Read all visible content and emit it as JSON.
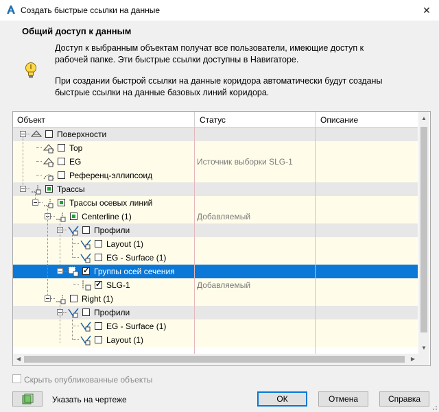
{
  "window": {
    "title": "Создать быстрые ссылки на данные",
    "close_glyph": "✕"
  },
  "header": {
    "heading": "Общий доступ к данным",
    "p1_line1": "Доступ к выбранным объектам получат все пользователи, имеющие доступ к",
    "p1_line2": "рабочей папке. Эти быстрые ссылки доступны в Навигаторе.",
    "p2_line1": "При создании быстрой ссылки на данные коридора автоматически будут созданы",
    "p2_line2": "быстрые ссылки на данные базовых линий коридора."
  },
  "tree": {
    "columns": [
      "Объект",
      "Статус",
      "Описание"
    ],
    "rows": [
      {
        "label": "Поверхности",
        "status": "",
        "checked": false,
        "type": "group",
        "icon": "surface-folder-icon"
      },
      {
        "label": "Top",
        "status": "",
        "checked": false,
        "type": "leaf",
        "icon": "surface-icon"
      },
      {
        "label": "EG",
        "status": "Источник выборки SLG-1",
        "checked": false,
        "type": "leaf",
        "icon": "surface-icon"
      },
      {
        "label": "Референц-эллипсоид",
        "status": "",
        "checked": false,
        "type": "leaf",
        "icon": "ellipsoid-icon"
      },
      {
        "label": "Трассы",
        "status": "",
        "checked": "partial",
        "type": "group",
        "icon": "alignments-icon"
      },
      {
        "label": "Трассы осевых линий",
        "status": "",
        "checked": "partial",
        "type": "group",
        "icon": "alignments-icon"
      },
      {
        "label": "Centerline (1)",
        "status": "Добавляемый",
        "checked": "partial",
        "type": "leaf",
        "icon": "alignment-icon"
      },
      {
        "label": "Профили",
        "status": "",
        "checked": false,
        "type": "group",
        "icon": "profiles-icon"
      },
      {
        "label": "Layout (1)",
        "status": "",
        "checked": false,
        "type": "leaf",
        "icon": "profile-icon"
      },
      {
        "label": "EG - Surface (1)",
        "status": "",
        "checked": false,
        "type": "leaf",
        "icon": "profile-icon"
      },
      {
        "label": "Группы осей сечения",
        "status": "",
        "checked": true,
        "type": "selected",
        "icon": "sample-lines-icon"
      },
      {
        "label": "SLG-1",
        "status": "Добавляемый",
        "checked": true,
        "type": "leaf",
        "icon": "sample-line-icon"
      },
      {
        "label": "Right (1)",
        "status": "",
        "checked": false,
        "type": "leaf",
        "icon": "alignment-icon"
      },
      {
        "label": "Профили",
        "status": "",
        "checked": false,
        "type": "group",
        "icon": "profiles-icon"
      },
      {
        "label": "EG - Surface (1)",
        "status": "",
        "checked": false,
        "type": "leaf",
        "icon": "profile-icon"
      },
      {
        "label": "Layout (1)",
        "status": "",
        "checked": false,
        "type": "leaf",
        "icon": "profile-icon"
      }
    ]
  },
  "footer": {
    "hide_published": "Скрыть опубликованные объекты",
    "pick_label": "Указать на чертеже",
    "ok": "ОК",
    "cancel": "Отмена",
    "help": "Справка"
  },
  "colors": {
    "selection": "#0b78d7",
    "leaf_row": "#fffde9",
    "group_row": "#e7e7e7"
  }
}
